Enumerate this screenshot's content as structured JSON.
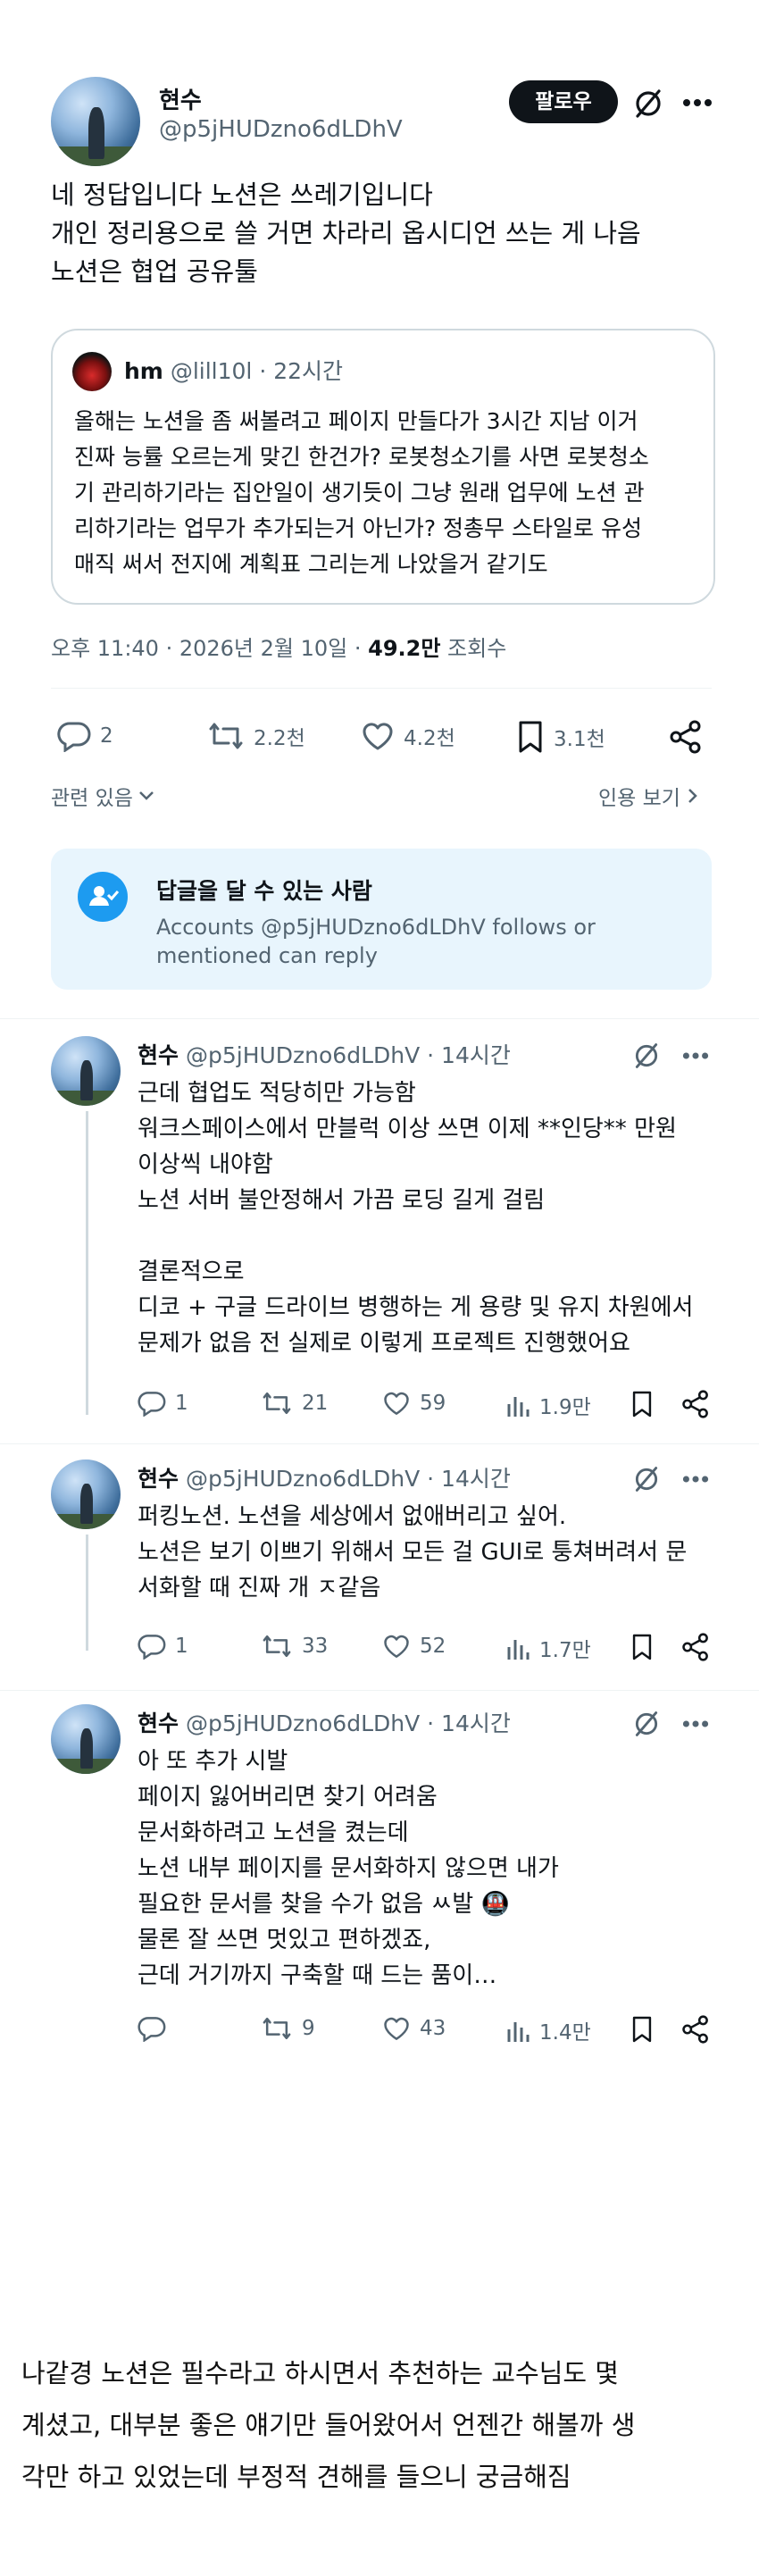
{
  "main_tweet": {
    "name": "현수",
    "handle": "@p5jHUDzno6dLDhV",
    "follow_label": "팔로우",
    "lines": [
      "네 정답입니다 노션은 쓰레기입니다",
      "개인 정리용으로 쓸 거면 차라리 옵시디언 쓰는 게 나음",
      "노션은 협업 공유툴"
    ],
    "quote": {
      "name": "hm",
      "handle": "@lill10l",
      "time": "· 22시간",
      "lines": [
        "올해는 노션을 좀 써볼려고 페이지 만들다가 3시간 지남 이거",
        "진짜 능률 오르는게 맞긴 한건가? 로봇청소기를 사면 로봇청소",
        "기 관리하기라는 집안일이 생기듯이 그냥 원래 업무에 노션 관",
        "리하기라는 업무가 추가되는거 아닌가? 정총무 스타일로 유성",
        "매직 써서 전지에 계획표 그리는게 나았을거 같기도"
      ]
    },
    "timestamp": "오후 11:40 · 2026년 2월 10일 · ",
    "views": "49.2만",
    "views_label": " 조회수",
    "actions": {
      "replies": "2",
      "retweets": "2.2천",
      "likes": "4.2천",
      "bookmarks": "3.1천"
    },
    "related": "관련 있음",
    "quotes_link": "인용 보기"
  },
  "reply_box": {
    "title": "답글을 달 수 있는 사람",
    "line1": "Accounts @p5jHUDzno6dLDhV follows or",
    "line2": "mentioned can reply"
  },
  "replies": [
    {
      "name": "현수",
      "handle": "@p5jHUDzno6dLDhV",
      "time": "· 14시간",
      "lines": [
        "근데 협업도 적당히만 가능함",
        "워크스페이스에서 만블럭 이상 쓰면 이제 **인당** 만원",
        "이상씩 내야함",
        "노션 서버 불안정해서 가끔 로딩 길게 걸림",
        "",
        "결론적으로",
        "디코 + 구글 드라이브 병행하는 게 용량 및 유지 차원에서",
        "문제가 없음 전 실제로 이렇게 프로젝트 진행했어요"
      ],
      "replies": "1",
      "retweets": "21",
      "likes": "59",
      "views": "1.9만"
    },
    {
      "name": "현수",
      "handle": "@p5jHUDzno6dLDhV",
      "time": "· 14시간",
      "lines": [
        "퍼킹노션. 노션을 세상에서 없애버리고 싶어.",
        "노션은 보기 이쁘기 위해서 모든 걸 GUI로 퉁쳐버려서 문",
        "서화할 때 진짜 개 ㅈ같음"
      ],
      "replies": "1",
      "retweets": "33",
      "likes": "52",
      "views": "1.7만"
    },
    {
      "name": "현수",
      "handle": "@p5jHUDzno6dLDhV",
      "time": "· 14시간",
      "lines": [
        "아 또 추가 시발",
        "페이지 잃어버리면 찾기 어려움",
        "문서화하려고 노션을 켰는데",
        "노션 내부 페이지를 문서화하지 않으면 내가",
        "필요한 문서를 찾을 수가 없음 ㅆ발 🚇",
        "물론 잘 쓰면 멋있고 편하겠죠,",
        "근데 거기까지 구축할 때 드는 품이…"
      ],
      "replies": "",
      "retweets": "9",
      "likes": "43",
      "views": "1.4만"
    }
  ],
  "caption": {
    "lines": [
      "나같경 노션은 필수라고 하시면서 추천하는 교수님도 몇",
      "계셨고, 대부분 좋은 얘기만 들어왔어서 언젠간 해볼까 생",
      "각만 하고 있었는데 부정적 견해를 들으니 궁금해짐"
    ]
  },
  "colors": {
    "text": "#0f1419",
    "secondary": "#536471",
    "accent": "#1d9bf0",
    "border": "#cfd9de",
    "info_bg": "#e8f5fd"
  }
}
